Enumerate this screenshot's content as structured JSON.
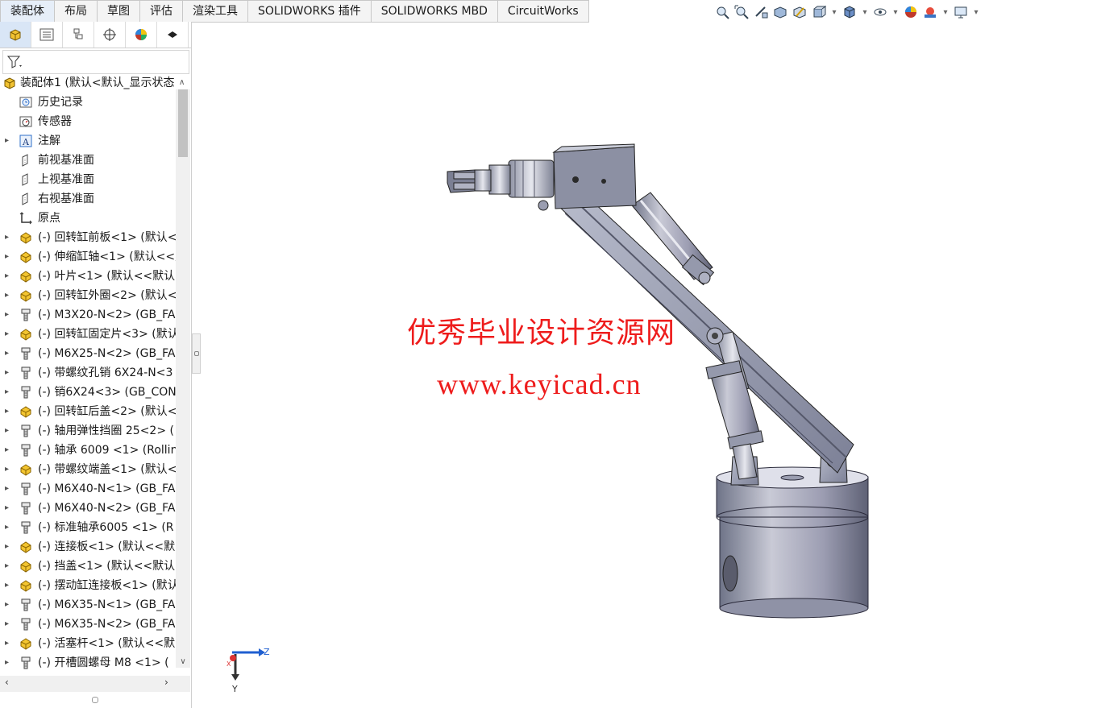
{
  "tabs": [
    {
      "label": "装配体",
      "active": true
    },
    {
      "label": "布局"
    },
    {
      "label": "草图"
    },
    {
      "label": "评估"
    },
    {
      "label": "渲染工具"
    },
    {
      "label": "SOLIDWORKS 插件"
    },
    {
      "label": "SOLIDWORKS MBD"
    },
    {
      "label": "CircuitWorks"
    }
  ],
  "tree": {
    "root": "装配体1 (默认<默认_显示状态",
    "items": [
      {
        "label": "历史记录",
        "icon": "history-icon",
        "expand": false
      },
      {
        "label": "传感器",
        "icon": "sensor-icon",
        "expand": false
      },
      {
        "label": "注解",
        "icon": "annotation-icon",
        "expand": true
      },
      {
        "label": "前视基准面",
        "icon": "plane-icon",
        "expand": false
      },
      {
        "label": "上视基准面",
        "icon": "plane-icon",
        "expand": false
      },
      {
        "label": "右视基准面",
        "icon": "plane-icon",
        "expand": false
      },
      {
        "label": "原点",
        "icon": "origin-icon",
        "expand": false
      },
      {
        "label": "(-) 回转缸前板<1> (默认<",
        "icon": "part-icon",
        "expand": true
      },
      {
        "label": "(-) 伸缩缸轴<1> (默认<<默认",
        "icon": "part-icon",
        "expand": true
      },
      {
        "label": "(-) 叶片<1> (默认<<默认",
        "icon": "part-icon",
        "expand": true
      },
      {
        "label": "(-) 回转缸外圈<2> (默认<",
        "icon": "part-icon",
        "expand": true
      },
      {
        "label": "(-) M3X20-N<2> (GB_FA",
        "icon": "bolt-icon",
        "expand": true
      },
      {
        "label": "(-) 回转缸固定片<3> (默认",
        "icon": "part-icon",
        "expand": true
      },
      {
        "label": "(-) M6X25-N<2> (GB_FA",
        "icon": "bolt-icon",
        "expand": true
      },
      {
        "label": "(-) 带螺纹孔销 6X24-N<3",
        "icon": "bolt-icon",
        "expand": true
      },
      {
        "label": "(-) 销6X24<3> (GB_CON",
        "icon": "bolt-icon",
        "expand": true
      },
      {
        "label": "(-) 回转缸后盖<2> (默认<",
        "icon": "part-icon",
        "expand": true
      },
      {
        "label": "(-) 轴用弹性挡圈 25<2> (",
        "icon": "bolt-icon",
        "expand": true
      },
      {
        "label": "(-) 轴承 6009 <1> (Rollin",
        "icon": "bolt-icon",
        "expand": true
      },
      {
        "label": "(-) 带螺纹端盖<1> (默认<",
        "icon": "part-icon",
        "expand": true
      },
      {
        "label": "(-) M6X40-N<1> (GB_FA",
        "icon": "bolt-icon",
        "expand": true
      },
      {
        "label": "(-) M6X40-N<2> (GB_FA",
        "icon": "bolt-icon",
        "expand": true
      },
      {
        "label": "(-) 标准轴承6005 <1> (R",
        "icon": "bolt-icon",
        "expand": true
      },
      {
        "label": "(-) 连接板<1> (默认<<默",
        "icon": "part-icon",
        "expand": true
      },
      {
        "label": "(-) 挡盖<1> (默认<<默认",
        "icon": "part-icon",
        "expand": true
      },
      {
        "label": "(-) 摆动缸连接板<1> (默认",
        "icon": "part-icon",
        "expand": true
      },
      {
        "label": "(-) M6X35-N<1> (GB_FA",
        "icon": "bolt-icon",
        "expand": true
      },
      {
        "label": "(-) M6X35-N<2> (GB_FA",
        "icon": "bolt-icon",
        "expand": true
      },
      {
        "label": "(-) 活塞杆<1> (默认<<默",
        "icon": "part-icon",
        "expand": true
      },
      {
        "label": "(-) 开槽圆螺母 M8 <1> (",
        "icon": "bolt-icon",
        "expand": true
      }
    ]
  },
  "watermark": {
    "line1": "优秀毕业设计资源网",
    "line2": "www.keyicad.cn",
    "color": "#ee1c1c"
  },
  "triad": {
    "z": "Z",
    "y": "Y",
    "x": "X"
  },
  "colors": {
    "part": "#e8b100",
    "metal": "#9aa0b4",
    "accent": "#2f6fc8"
  }
}
